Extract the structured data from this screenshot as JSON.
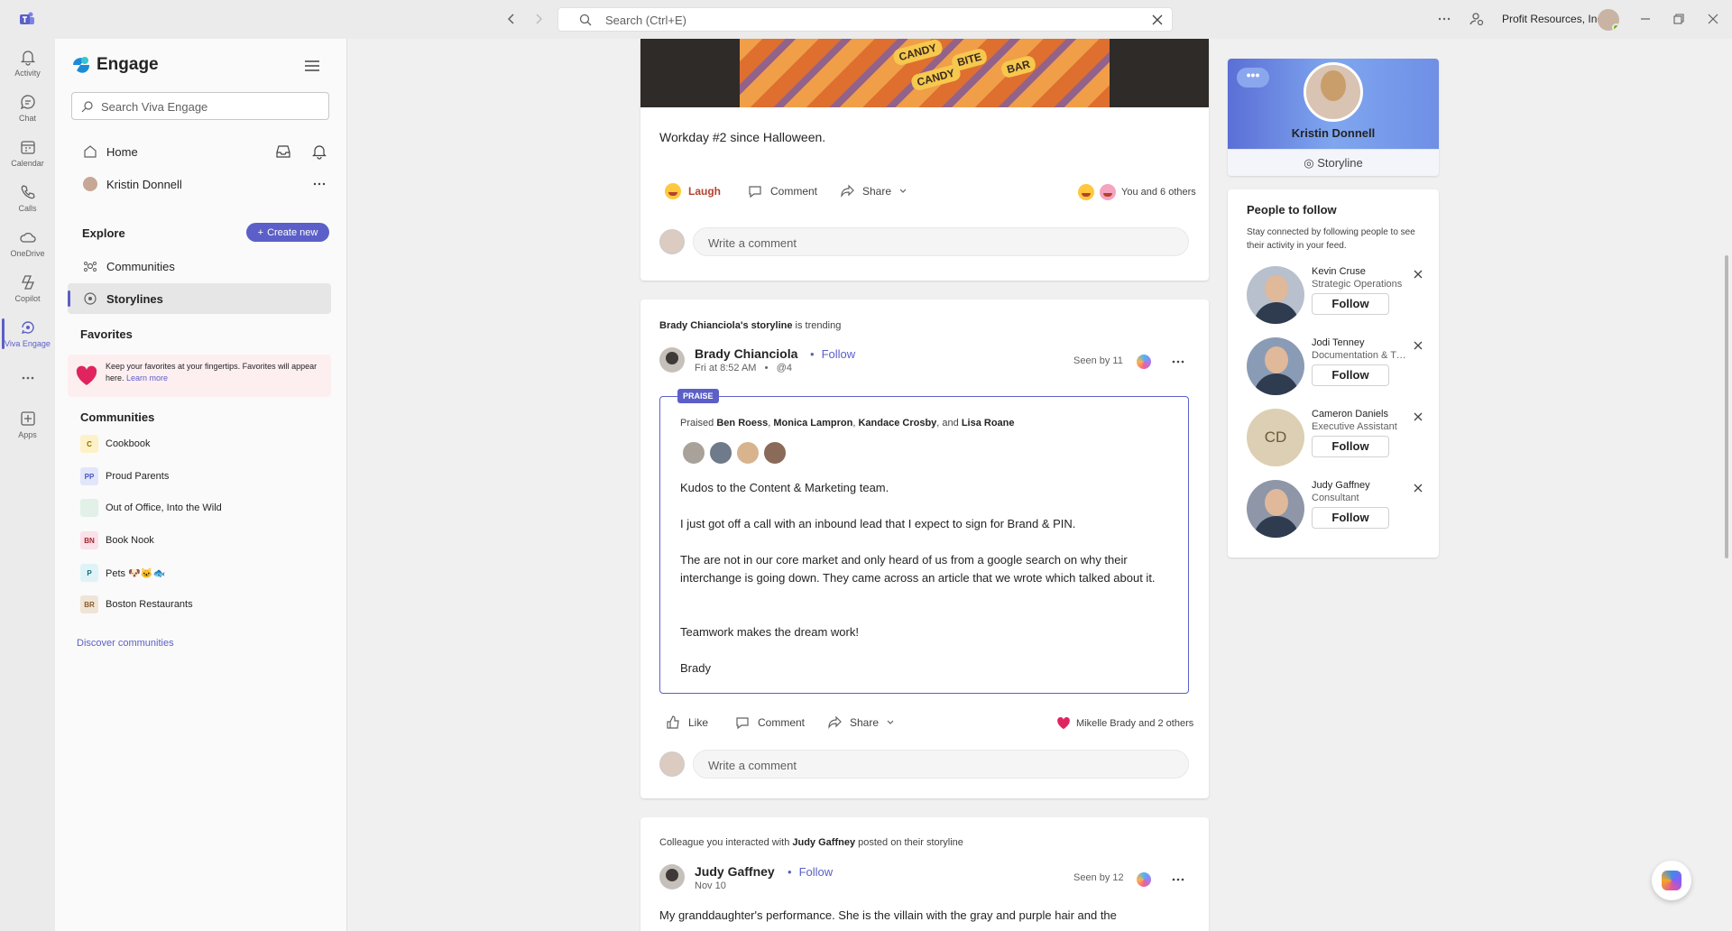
{
  "titlebar": {
    "search_placeholder": "Search (Ctrl+E)",
    "org_name": "Profit Resources, Inc."
  },
  "rail": {
    "items": [
      {
        "label": "Activity",
        "icon": "bell-icon"
      },
      {
        "label": "Chat",
        "icon": "chat-icon"
      },
      {
        "label": "Calendar",
        "icon": "calendar-icon"
      },
      {
        "label": "Calls",
        "icon": "phone-icon"
      },
      {
        "label": "OneDrive",
        "icon": "cloud-icon"
      },
      {
        "label": "Copilot",
        "icon": "copilot-icon"
      },
      {
        "label": "Viva Engage",
        "icon": "engage-icon"
      },
      {
        "label": "Apps",
        "icon": "plus-box-icon"
      }
    ]
  },
  "leftnav": {
    "brand": "Engage",
    "search_placeholder": "Search Viva Engage",
    "home": "Home",
    "user": "Kristin Donnell",
    "explore_header": "Explore",
    "create_new": "Create new",
    "communities_link": "Communities",
    "storylines_link": "Storylines",
    "favorites_header": "Favorites",
    "favorites_hint": "Keep your favorites at your fingertips. Favorites will appear here.",
    "favorites_learn_more": "Learn more",
    "communities_header": "Communities",
    "communities": [
      {
        "badge": "C",
        "name": "Cookbook",
        "bg": "#fdf2c7",
        "fg": "#8a6d00"
      },
      {
        "badge": "PP",
        "name": "Proud Parents",
        "bg": "#e2e6fb",
        "fg": "#4b53bc"
      },
      {
        "badge": "",
        "name": "Out of Office, Into the Wild",
        "bg": "#e1f1e7",
        "fg": "#237b4b"
      },
      {
        "badge": "BN",
        "name": "Book Nook",
        "bg": "#fbe1e9",
        "fg": "#a4262c"
      },
      {
        "badge": "P",
        "name": "Pets 🐶🐱🐟",
        "bg": "#dff3f7",
        "fg": "#0f6c7c"
      },
      {
        "badge": "BR",
        "name": "Boston Restaurants",
        "bg": "#efe4d6",
        "fg": "#8a5a2b"
      }
    ],
    "discover": "Discover communities"
  },
  "feed": {
    "post1": {
      "text": "Workday #2 since Halloween.",
      "image_words": [
        "CANDY",
        "BITE",
        "BAR",
        "CANDY"
      ],
      "reaction_label": "Laugh",
      "comment_label": "Comment",
      "share_label": "Share",
      "reaction_summary": "You and 6 others",
      "comment_placeholder": "Write a comment"
    },
    "post2": {
      "trend_name": "Brady Chianciola's storyline",
      "trend_suffix": " is trending",
      "author": "Brady Chianciola",
      "follow": "Follow",
      "meta_time": "Fri at 8:52 AM",
      "meta_sep": "•",
      "meta_mentions": "@4",
      "seen": "Seen by 11",
      "praise_tag": "PRAISE",
      "praised_prefix": "Praised ",
      "praised_names": [
        "Ben Roess",
        "Monica Lampron",
        "Kandace Crosby",
        "Lisa Roane"
      ],
      "praised_sep1": ", ",
      "praised_sep2": ", ",
      "praised_and": ", and ",
      "body": [
        "Kudos to the Content & Marketing team.",
        "I just got off a call with an inbound lead that I expect to sign for Brand & PIN.",
        "The are not in our core market and only heard of us from a google search on why their interchange is going down.  They came across an article that we wrote which talked about it.",
        "Teamwork makes the dream work!",
        "Brady"
      ],
      "like_label": "Like",
      "comment_label": "Comment",
      "share_label": "Share",
      "reaction_summary": "Mikelle Brady and 2 others",
      "comment_placeholder": "Write a comment"
    },
    "post3": {
      "trend_prefix": "Colleague you interacted with ",
      "trend_name": "Judy Gaffney",
      "trend_suffix": " posted on their storyline",
      "author": "Judy Gaffney",
      "follow": "Follow",
      "meta_time": "Nov 10",
      "seen": "Seen by 12",
      "text": "My granddaughter's performance.  She is the villain with the gray and purple hair and the"
    }
  },
  "profile": {
    "name": "Kristin Donnell",
    "storyline": "Storyline"
  },
  "people_to_follow": {
    "title": "People to follow",
    "subtitle": "Stay connected by following people to see their activity in your feed.",
    "people": [
      {
        "name": "Kevin Cruse",
        "title": "Strategic Operations",
        "follow": "Follow"
      },
      {
        "name": "Jodi Tenney",
        "title": "Documentation & Training",
        "follow": "Follow"
      },
      {
        "name": "Cameron Daniels",
        "title": "Executive Assistant",
        "follow": "Follow",
        "initials": "CD"
      },
      {
        "name": "Judy Gaffney",
        "title": "Consultant",
        "follow": "Follow"
      }
    ]
  },
  "colors": {
    "accent": "#5b5fc7",
    "heart": "#e0245e"
  }
}
